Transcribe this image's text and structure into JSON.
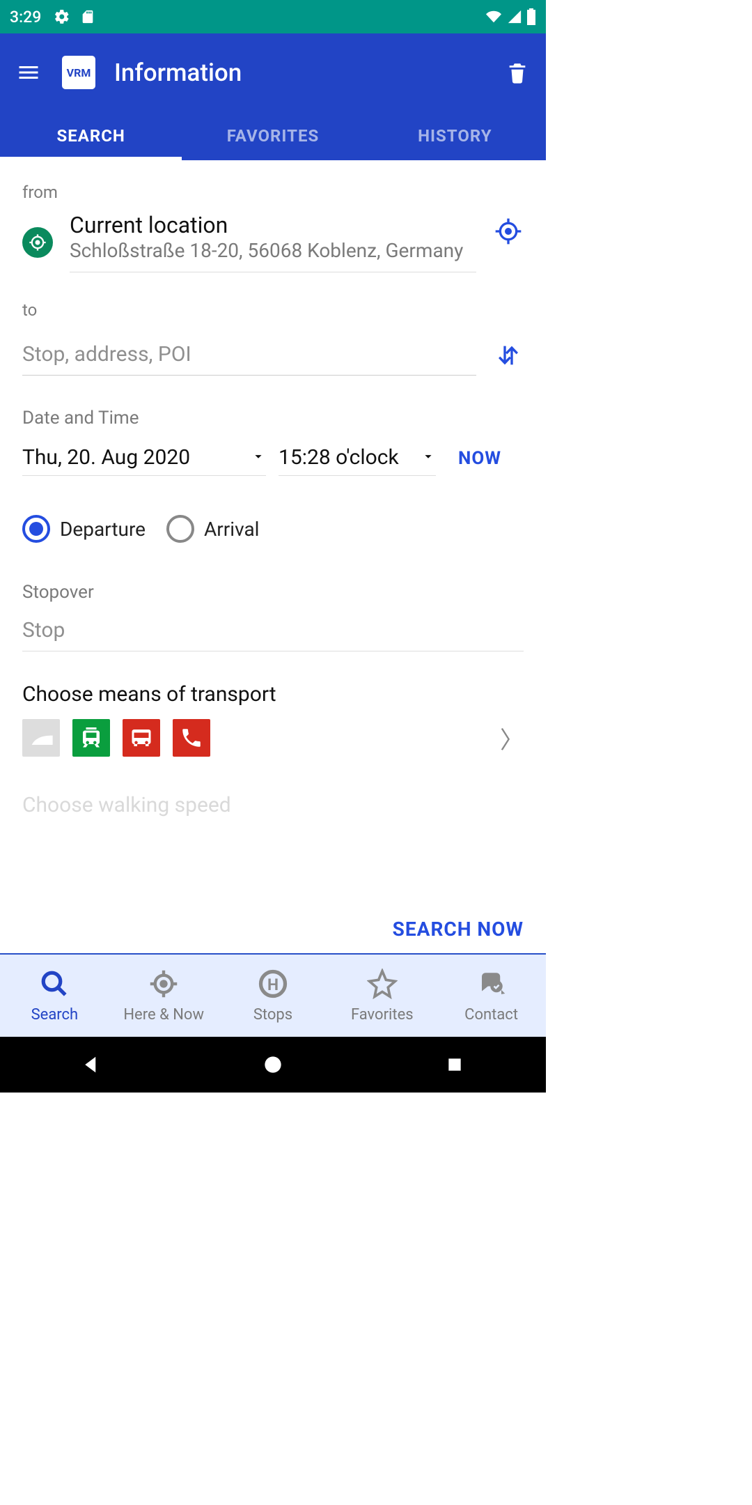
{
  "status_bar": {
    "time": "3:29"
  },
  "header": {
    "title": "Information"
  },
  "tabs": [
    {
      "label": "SEARCH",
      "active": true
    },
    {
      "label": "FAVORITES",
      "active": false
    },
    {
      "label": "HISTORY",
      "active": false
    }
  ],
  "from": {
    "label": "from",
    "title": "Current location",
    "subtitle": "Schloßstraße 18-20, 56068 Koblenz, Germany"
  },
  "to": {
    "label": "to",
    "placeholder": "Stop, address, POI"
  },
  "date_time": {
    "label": "Date and Time",
    "date": "Thu, 20. Aug 2020",
    "time": "15:28 o'clock",
    "now_label": "NOW"
  },
  "mode": {
    "departure_label": "Departure",
    "arrival_label": "Arrival",
    "selected": "departure"
  },
  "stopover": {
    "label": "Stopover",
    "placeholder": "Stop"
  },
  "transport": {
    "label": "Choose means of transport"
  },
  "walking": {
    "label": "Choose walking speed"
  },
  "search_now_label": "SEARCH NOW",
  "bottom_nav": [
    {
      "label": "Search",
      "active": true
    },
    {
      "label": "Here & Now",
      "active": false
    },
    {
      "label": "Stops",
      "active": false
    },
    {
      "label": "Favorites",
      "active": false
    },
    {
      "label": "Contact",
      "active": false
    }
  ]
}
